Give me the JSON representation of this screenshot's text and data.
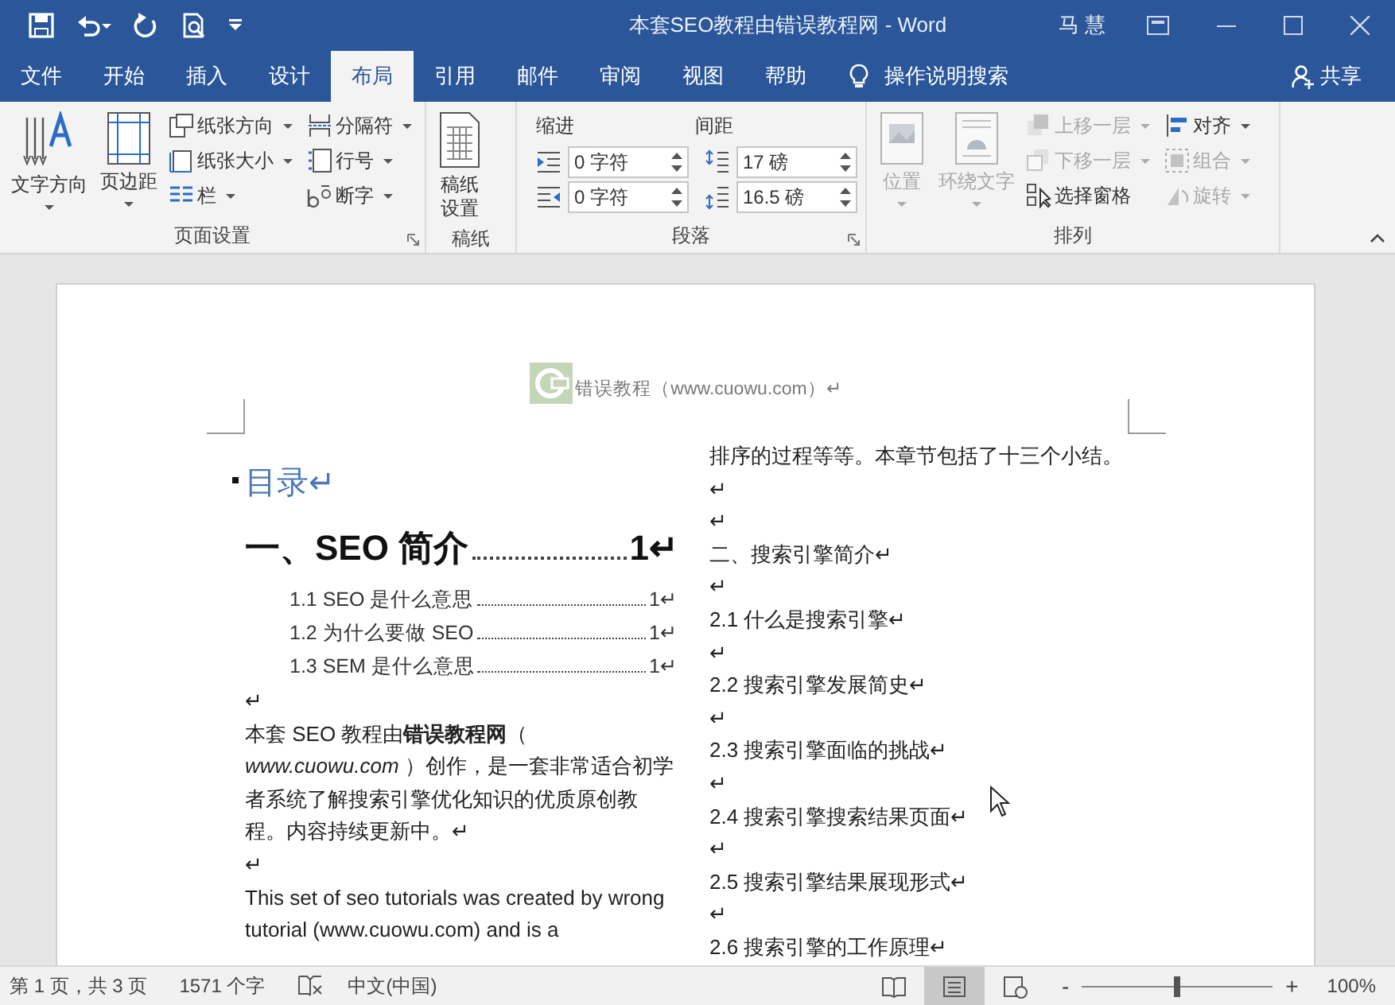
{
  "window": {
    "title": "本套SEO教程由错误教程网  -  Word",
    "user": "马 慧"
  },
  "tabs": [
    {
      "label": "文件",
      "selected": false
    },
    {
      "label": "开始",
      "selected": false
    },
    {
      "label": "插入",
      "selected": false
    },
    {
      "label": "设计",
      "selected": false
    },
    {
      "label": "布局",
      "selected": true
    },
    {
      "label": "引用",
      "selected": false
    },
    {
      "label": "邮件",
      "selected": false
    },
    {
      "label": "审阅",
      "selected": false
    },
    {
      "label": "视图",
      "selected": false
    },
    {
      "label": "帮助",
      "selected": false
    }
  ],
  "tell_me": "操作说明搜索",
  "share": "共享",
  "ribbon": {
    "groups": [
      {
        "name": "页面设置",
        "launcher": true,
        "kind": "buttons",
        "items": [
          {
            "label": "文字方向",
            "kind": "large",
            "dropdown": true,
            "disabled": false
          },
          {
            "label": "页边距",
            "kind": "large",
            "dropdown": true,
            "disabled": false
          },
          {
            "label": "纸张方向",
            "kind": "small",
            "dropdown": true,
            "disabled": false
          },
          {
            "label": "纸张大小",
            "kind": "small",
            "dropdown": true,
            "disabled": false
          },
          {
            "label": "栏",
            "kind": "small",
            "dropdown": true,
            "disabled": false
          },
          {
            "label": "分隔符",
            "kind": "small",
            "dropdown": true,
            "disabled": false
          },
          {
            "label": "行号",
            "kind": "small",
            "dropdown": true,
            "disabled": false
          },
          {
            "label": "断字",
            "kind": "small",
            "dropdown": true,
            "disabled": false
          }
        ]
      },
      {
        "name": "稿纸",
        "launcher": false,
        "kind": "buttons",
        "items": [
          {
            "label": "稿纸设置",
            "kind": "large",
            "dropdown": false,
            "disabled": false
          }
        ]
      },
      {
        "name": "段落",
        "launcher": true,
        "kind": "paragraph",
        "indent_label": "缩进",
        "spacing_label": "间距",
        "fields": [
          {
            "value": "0 字符"
          },
          {
            "value": "0 字符"
          },
          {
            "value": "17 磅"
          },
          {
            "value": "16.5 磅"
          }
        ]
      },
      {
        "name": "排列",
        "launcher": false,
        "kind": "buttons",
        "items": [
          {
            "label": "位置",
            "kind": "large",
            "dropdown": true,
            "disabled": true
          },
          {
            "label": "环绕文字",
            "kind": "large",
            "dropdown": true,
            "disabled": true
          },
          {
            "label": "上移一层",
            "kind": "small",
            "dropdown": true,
            "disabled": true
          },
          {
            "label": "下移一层",
            "kind": "small",
            "dropdown": true,
            "disabled": true
          },
          {
            "label": "选择窗格",
            "kind": "small",
            "dropdown": false,
            "disabled": false
          },
          {
            "label": "对齐",
            "kind": "small",
            "dropdown": true,
            "disabled": false
          },
          {
            "label": "组合",
            "kind": "small",
            "dropdown": true,
            "disabled": true
          },
          {
            "label": "旋转",
            "kind": "small",
            "dropdown": true,
            "disabled": true
          }
        ]
      }
    ]
  },
  "document": {
    "header": "错误教程（www.cuowu.com）↵",
    "left_column": [
      {
        "kind": "toc_title",
        "text": "目录↵"
      },
      {
        "kind": "toc1",
        "text": "一、SEO 简介",
        "page": "1↵"
      },
      {
        "kind": "toc2",
        "text": "1.1 SEO 是什么意思",
        "page": "1↵"
      },
      {
        "kind": "toc2",
        "text": "1.2  为什么要做 SEO",
        "page": "1↵"
      },
      {
        "kind": "toc2",
        "text": "1.3 SEM 是什么意思",
        "page": "1↵"
      },
      {
        "kind": "para",
        "text": "↵"
      },
      {
        "kind": "para",
        "text": "本套 SEO 教程由**错误教程网**（ *www.cuowu.com* ）创作，是一套非常适合初学者系统了解搜索引擎优化知识的优质原创教程。内容持续更新中。↵"
      },
      {
        "kind": "para",
        "text": "↵"
      },
      {
        "kind": "para",
        "text": "This set of seo tutorials was created by wrong tutorial (www.cuowu.com) and is a"
      }
    ],
    "right_column": [
      {
        "kind": "para",
        "text": "排序的过程等等。本章节包括了十三个小结。↵"
      },
      {
        "kind": "para",
        "text": "↵"
      },
      {
        "kind": "para",
        "text": "二、搜索引擎简介↵"
      },
      {
        "kind": "para",
        "text": "↵"
      },
      {
        "kind": "para",
        "text": "2.1 什么是搜索引擎↵"
      },
      {
        "kind": "para",
        "text": "↵"
      },
      {
        "kind": "para",
        "text": "2.2 搜索引擎发展简史↵"
      },
      {
        "kind": "para",
        "text": "↵"
      },
      {
        "kind": "para",
        "text": "2.3 搜索引擎面临的挑战↵"
      },
      {
        "kind": "para",
        "text": "↵"
      },
      {
        "kind": "para",
        "text": "2.4 搜索引擎搜索结果页面↵"
      },
      {
        "kind": "para",
        "text": "↵"
      },
      {
        "kind": "para",
        "text": "2.5 搜索引擎结果展现形式↵"
      },
      {
        "kind": "para",
        "text": "↵"
      },
      {
        "kind": "para",
        "text": "2.6 搜索引擎的工作原理↵"
      }
    ]
  },
  "status_bar": {
    "page": "第 1 页，共 3 页",
    "words": "1571 个字",
    "language": "中文(中国)",
    "views": [
      {
        "kind": "read",
        "selected": false
      },
      {
        "kind": "print",
        "selected": true
      },
      {
        "kind": "web",
        "selected": false
      }
    ],
    "zoom": {
      "minus": "-",
      "plus": "+",
      "level": 0.5,
      "reading": "100%"
    }
  }
}
